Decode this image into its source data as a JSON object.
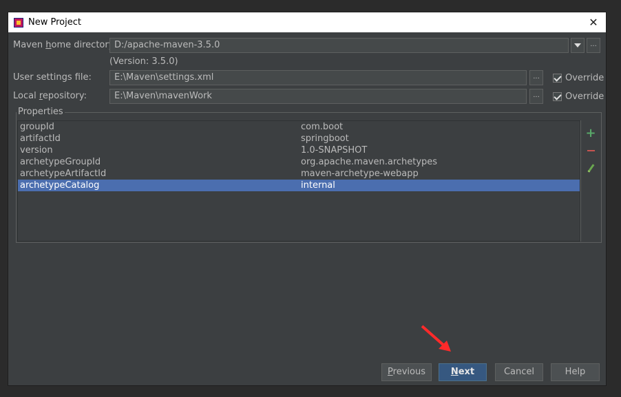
{
  "window": {
    "title": "New Project",
    "close_label": "✕"
  },
  "maven_home": {
    "label_pre": "Maven ",
    "label_mnemonic": "h",
    "label_post": "ome directory:",
    "value": "D:/apache-maven-3.5.0",
    "version": "(Version: 3.5.0)"
  },
  "user_settings": {
    "label": "User settings file:",
    "value": "E:\\Maven\\settings.xml",
    "override_label": "Override",
    "override_checked": true
  },
  "local_repo": {
    "label_pre": "Local ",
    "label_mnemonic": "r",
    "label_post": "epository:",
    "value": "E:\\Maven\\mavenWork",
    "override_label": "Override",
    "override_checked": true
  },
  "browse_label": "...",
  "properties": {
    "title": "Properties",
    "rows": [
      {
        "key": "groupId",
        "value": "com.boot"
      },
      {
        "key": "artifactId",
        "value": "springboot"
      },
      {
        "key": "version",
        "value": "1.0-SNAPSHOT"
      },
      {
        "key": "archetypeGroupId",
        "value": "org.apache.maven.archetypes"
      },
      {
        "key": "archetypeArtifactId",
        "value": "maven-archetype-webapp"
      },
      {
        "key": "archetypeCatalog",
        "value": "internal"
      }
    ],
    "selected_row": "archetypeCatalog",
    "toolbar": [
      "plus-icon",
      "minus-icon",
      "pencil-icon"
    ]
  },
  "buttons": {
    "previous_mnemonic": "P",
    "previous_rest": "revious",
    "next_mnemonic": "N",
    "next_rest": "ext",
    "cancel": "Cancel",
    "help": "Help"
  },
  "colors": {
    "accent": "#4b6eaf",
    "default_button": "#365880",
    "annotation_arrow": "#ff2a2a"
  }
}
